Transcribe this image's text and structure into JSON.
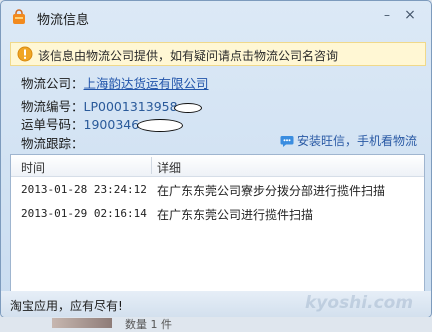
{
  "window": {
    "title": "物流信息",
    "minimize_glyph": "–",
    "close_glyph": "×",
    "title_icon": "shopping-bag-icon"
  },
  "notice": {
    "icon": "info-icon",
    "text": "该信息由物流公司提供，如有疑问请点击物流公司名咨询"
  },
  "info": {
    "company_label": "物流公司：",
    "company_value": "上海韵达货运有限公司",
    "tracking_label": "物流编号：",
    "tracking_value": "LP0001313958",
    "waybill_label": "运单号码：",
    "waybill_value": "1900346",
    "trace_label": "物流跟踪："
  },
  "wangwang_link": {
    "icon": "wangwang-chat-icon",
    "text": "安装旺信，手机看物流"
  },
  "table": {
    "headers": [
      "时间",
      "详细"
    ],
    "rows": [
      {
        "time": "2013-01-28 23:24:12",
        "detail": "在广东东莞公司寮步分拨分部进行揽件扫描"
      },
      {
        "time": "2013-01-29 02:16:14",
        "detail": "在广东东莞公司进行揽件扫描"
      }
    ]
  },
  "footer": {
    "text": "淘宝应用，应有尽有!"
  },
  "watermark": {
    "text": "kyoshi.com"
  },
  "background": {
    "partial_text": "数量 1  件"
  }
}
